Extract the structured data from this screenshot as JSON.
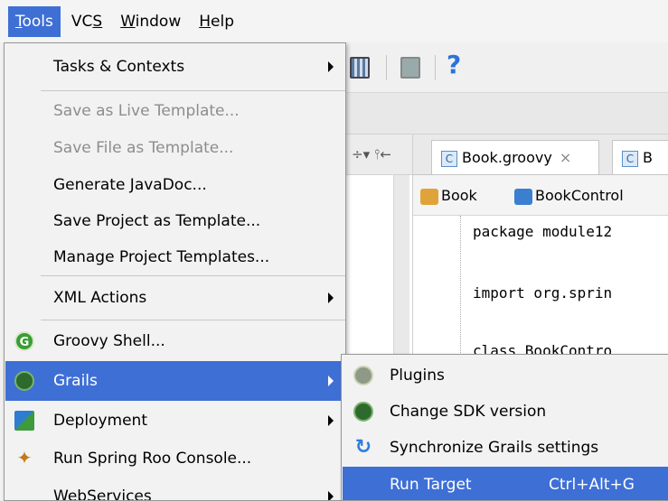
{
  "menubar": {
    "items": [
      {
        "label": "Tools",
        "mnemonic_index": 0,
        "active": true
      },
      {
        "label": "VCS",
        "mnemonic_index": 2,
        "active": false
      },
      {
        "label": "Window",
        "mnemonic_index": 0,
        "active": false
      },
      {
        "label": "Help",
        "mnemonic_index": 0,
        "active": false
      }
    ]
  },
  "tools_menu": {
    "items": {
      "tasks": {
        "label": "Tasks & Contexts"
      },
      "save_live_template": {
        "label": "Save as Live Template..."
      },
      "save_file_template": {
        "label": "Save File as Template..."
      },
      "generate_javadoc": {
        "label": "Generate JavaDoc..."
      },
      "save_project_template": {
        "label": "Save Project as Template..."
      },
      "manage_project_templates": {
        "label": "Manage Project Templates..."
      },
      "xml_actions": {
        "label": "XML Actions"
      },
      "groovy_shell": {
        "label": "Groovy Shell..."
      },
      "grails": {
        "label": "Grails"
      },
      "deployment": {
        "label": "Deployment"
      },
      "run_spring_roo": {
        "label": "Run Spring Roo Console..."
      },
      "webservices": {
        "label": "WebServices"
      }
    }
  },
  "grails_submenu": {
    "plugins": {
      "label": "Plugins"
    },
    "change_sdk": {
      "label": "Change SDK version"
    },
    "synchronize": {
      "label": "Synchronize Grails settings"
    },
    "run_target": {
      "label": "Run Target",
      "shortcut": "Ctrl+Alt+G"
    }
  },
  "editor": {
    "tabs": [
      {
        "label": "Book.groovy",
        "icon": "C"
      },
      {
        "label": "B",
        "icon": "C"
      }
    ],
    "tab_close": "×",
    "breadcrumbs": [
      "Book",
      "BookControl"
    ],
    "code_lines": [
      "package module12",
      "import org.sprin",
      "class BookContro"
    ]
  },
  "toolbar": {
    "help": "?"
  },
  "panel_header": "÷▾ ⫯←",
  "colors": {
    "accent": "#3e6fd5",
    "menu_bg": "#f2f2f2",
    "disabled": "#8d8d8d"
  }
}
